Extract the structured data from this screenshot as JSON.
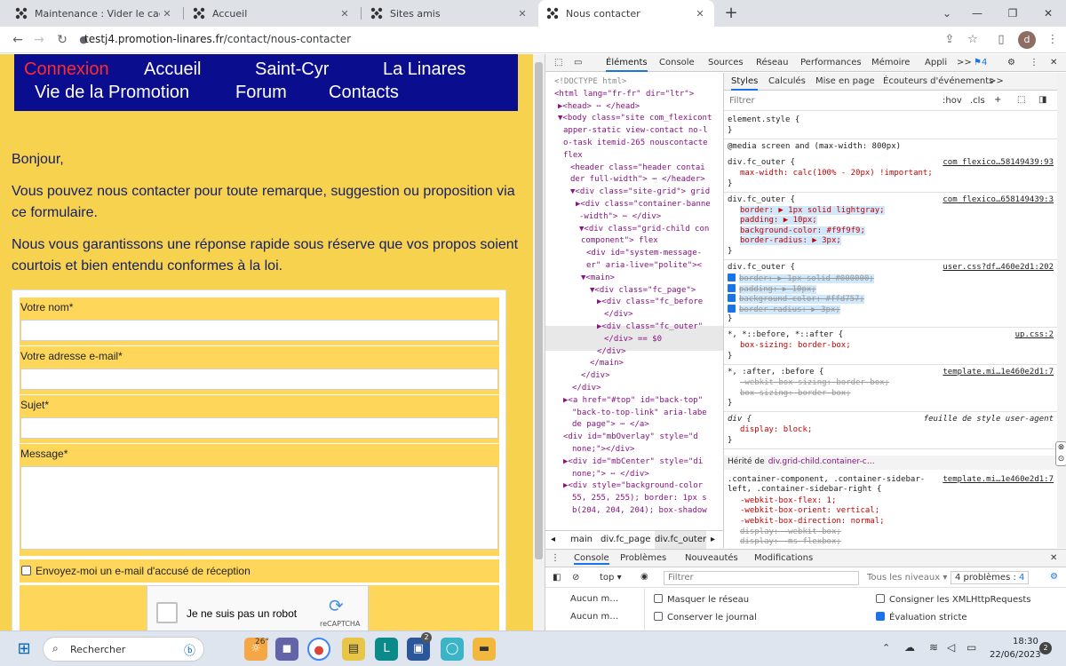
{
  "browser": {
    "tabs": [
      {
        "title": "Maintenance : Vider le cache - Si",
        "active": false
      },
      {
        "title": "Accueil",
        "active": false
      },
      {
        "title": "Sites amis",
        "active": false
      },
      {
        "title": "Nous contacter",
        "active": true
      }
    ],
    "new_tab": "+",
    "url_host": "testj4.promotion-linares.fr",
    "url_path": "/contact/nous-contacter",
    "profile_initial": "d"
  },
  "site": {
    "nav": [
      "Connexion",
      "Accueil",
      "Saint-Cyr",
      "La Linares",
      "Vie de la Promotion",
      "Forum",
      "Contacts"
    ],
    "greeting": "Bonjour,",
    "para1": "Vous pouvez nous contacter pour toute remarque, suggestion ou proposition via ce formulaire.",
    "para2": "Nous vous garantissons une réponse rapide sous réserve que vos propos soient courtois et bien entendu conformes à la loi.",
    "form": {
      "name_label": "Votre nom",
      "email_label": "Votre adresse e-mail",
      "subject_label": "Sujet",
      "message_label": "Message",
      "required_mark": "*",
      "copy_label": "Envoyez-moi un e-mail d'accusé de réception",
      "captcha_label": "Je ne suis pas un robot",
      "captcha_brand": "reCAPTCHA"
    }
  },
  "devtools": {
    "tabs": [
      "Éléments",
      "Console",
      "Sources",
      "Réseau",
      "Performances",
      "Mémoire",
      "Appli"
    ],
    "more": ">>",
    "issues_badge": "4",
    "elements_lines": [
      {
        "t": "<!DOCTYPE html>"
      },
      {
        "t": "<html lang=\"fr-fr\" dir=\"ltr\">"
      },
      {
        "t": "▶<head> ⋯ </head>"
      },
      {
        "t": "▼<body class=\"site com_flexicont"
      },
      {
        "t": "apper-static view-contact no-l"
      },
      {
        "t": "o-task itemid-265 nouscontacte"
      },
      {
        "t": "flex"
      },
      {
        "t": "<header class=\"header contai"
      },
      {
        "t": "der full-width\"> ⋯ </header>"
      },
      {
        "t": "▼<div class=\"site-grid\"> grid"
      },
      {
        "t": "▶<div class=\"container-banne"
      },
      {
        "t": "-width\"> ⋯ </div>"
      },
      {
        "t": "▼<div class=\"grid-child con"
      },
      {
        "t": "component\"> flex"
      },
      {
        "t": "<div id=\"system-message-"
      },
      {
        "t": "er\" aria-live=\"polite\"><"
      },
      {
        "t": "▼<main>"
      },
      {
        "t": "▼<div class=\"fc_page\">"
      },
      {
        "t": "▶<div class=\"fc_before"
      },
      {
        "t": "</div>"
      },
      {
        "t": "▶<div class=\"fc_outer\""
      },
      {
        "t": "</div> == $0"
      },
      {
        "t": "</div>"
      },
      {
        "t": "</main>"
      },
      {
        "t": "</div>"
      },
      {
        "t": "</div>"
      },
      {
        "t": "▶<a href=\"#top\" id=\"back-top\""
      },
      {
        "t": "\"back-to-top-link\" aria-labe"
      },
      {
        "t": "de page\"> ⋯ </a>"
      },
      {
        "t": "<div id=\"mbOverlay\" style=\"d"
      },
      {
        "t": "none;\"></div>"
      },
      {
        "t": "▶<div id=\"mbCenter\" style=\"di"
      },
      {
        "t": "none;\"> ⋯ </div>"
      },
      {
        "t": "▶<div style=\"background-color"
      },
      {
        "t": "55, 255, 255); border: 1px s"
      },
      {
        "t": "b(204, 204, 204); box-shadow"
      }
    ],
    "breadcrumbs": [
      "main",
      "div.fc_page",
      "div.fc_outer"
    ],
    "styles_tabs": [
      "Styles",
      "Calculés",
      "Mise en page",
      "Écouteurs d'événements"
    ],
    "filter_placeholder": "Filtrer",
    "hov": ":hov",
    "cls": ".cls",
    "rules": [
      {
        "selector": "element.style {",
        "src": "",
        "props": []
      },
      {
        "selector": "@media screen and (max-width: 800px)",
        "src": "",
        "props": []
      },
      {
        "selector": "div.fc_outer {",
        "src": "com_flexico…58149439:93",
        "props": [
          "max-width: calc(100% - 20px) !important;"
        ]
      },
      {
        "selector": "div.fc_outer {",
        "src": "com_flexico…658149439:3",
        "props": [
          "border: ▶ 1px solid lightgray;",
          "padding: ▶ 10px;",
          "background-color: #f9f9f9;",
          "border-radius: ▶ 3px;"
        ]
      },
      {
        "selector": "div.fc_outer {",
        "src": "user.css?df…460e2d1:202",
        "props": [
          "border: ▶ 1px solid #000000;",
          "padding: ▶ 10px;",
          "background-color: #ffd757;",
          "border-radius: ▶ 3px;"
        ]
      },
      {
        "selector": "*, *::before, *::after {",
        "src": "up.css:2",
        "props": [
          "box-sizing: border-box;"
        ]
      },
      {
        "selector": "*, :after, :before {",
        "src": "template.mi…1e460e2d1:7",
        "props": [
          "-webkit-box-sizing: border-box;",
          "box-sizing: border-box;"
        ]
      },
      {
        "selector": "div {",
        "src": "feuille de style user-agent",
        "props": [
          "display: block;"
        ]
      }
    ],
    "inherited_label": "Hérité de",
    "inherited_from": "div.grid-child.container-c…",
    "inherited_selector": ".container-component, .container-sidebar-left, .container-sidebar-right {",
    "inherited_src": "template.mi…1e460e2d1:7",
    "inherited_props": [
      "-webkit-box-flex: 1;",
      "-webkit-box-orient: vertical;",
      "-webkit-box-direction: normal;",
      "display: -webkit-box;",
      "display: -ms-flexbox;"
    ],
    "drawer": {
      "tabs": [
        "Console",
        "Problèmes",
        "Nouveautés",
        "Modifications"
      ],
      "context": "top",
      "filter": "Filtrer",
      "levels": "Tous les niveaux",
      "problems": "4 problèmes :",
      "problems_count": "4",
      "sidebar_items": [
        "Aucun m…",
        "Aucun m…"
      ],
      "options": [
        {
          "label": "Masquer le réseau",
          "checked": false
        },
        {
          "label": "Consigner les XMLHttpRequests",
          "checked": false
        },
        {
          "label": "Conserver le journal",
          "checked": false
        },
        {
          "label": "Évaluation stricte",
          "checked": true
        }
      ]
    }
  },
  "taskbar": {
    "search": "Rechercher",
    "temp": "26°",
    "time": "18:30",
    "date": "22/06/2023",
    "notif": "2",
    "badge": "2"
  }
}
